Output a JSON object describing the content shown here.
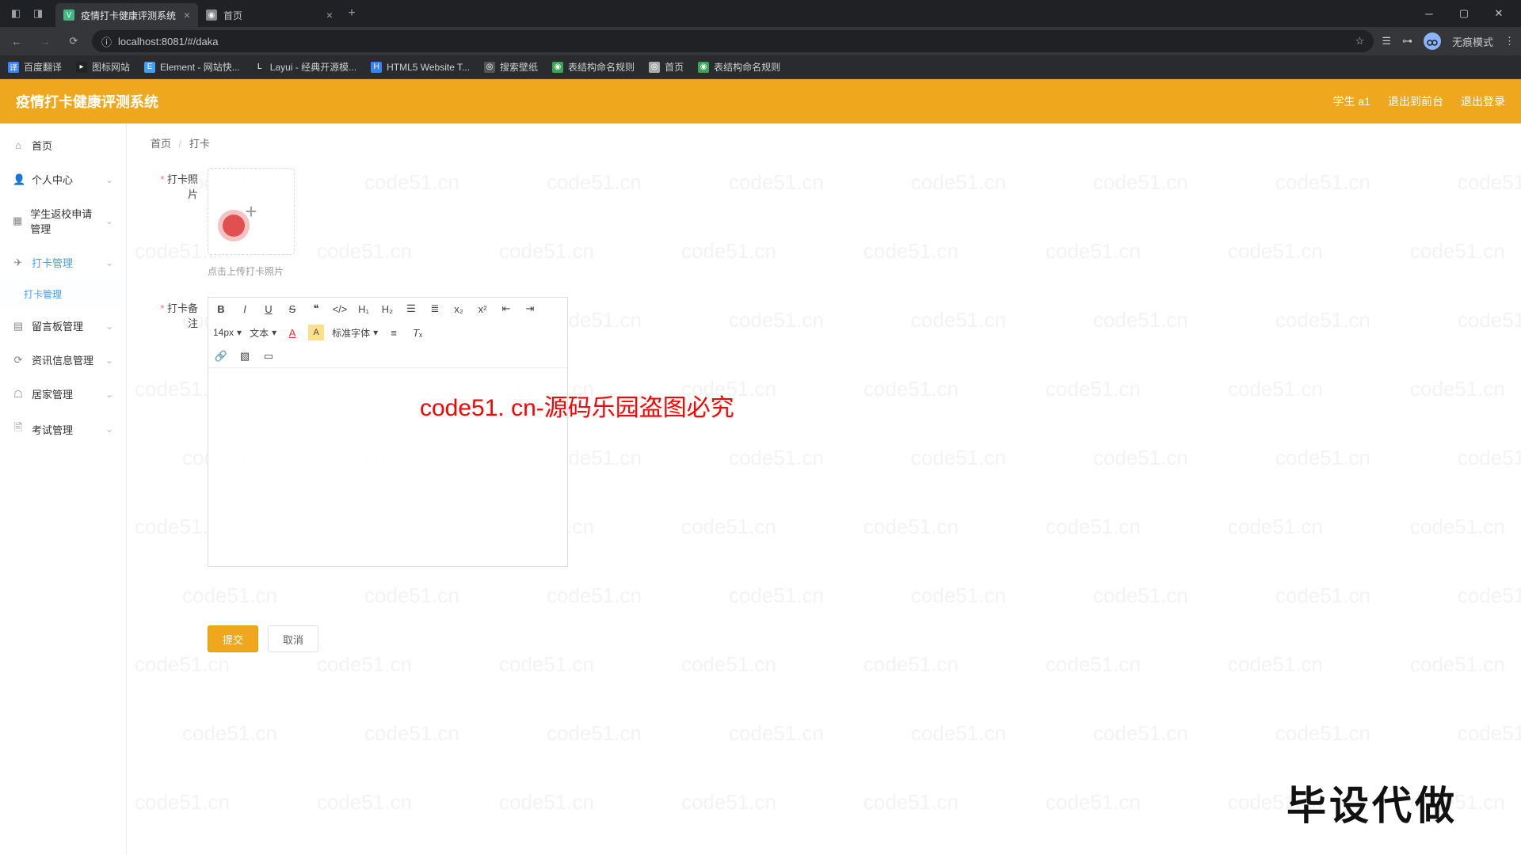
{
  "colors": {
    "accent": "#efa81e",
    "link": "#409EFF",
    "danger": "#f56c6c"
  },
  "browser": {
    "tabs": [
      {
        "title": "疫情打卡健康评测系统",
        "active": true,
        "favicon": "V",
        "favbg": "#41b883"
      },
      {
        "title": "首页",
        "active": false,
        "favicon": "◉",
        "favbg": "#888"
      }
    ],
    "url": "localhost:8081/#/daka",
    "incognito": "无痕模式",
    "bookmarks": [
      {
        "label": "百度翻译",
        "ic": "译",
        "bg": "#3b82f6"
      },
      {
        "label": "图标网站",
        "ic": "▸",
        "bg": "#222"
      },
      {
        "label": "Element - 网站快...",
        "ic": "E",
        "bg": "#409eff"
      },
      {
        "label": "Layui - 经典开源模...",
        "ic": "L",
        "bg": "#2a2a2a"
      },
      {
        "label": "HTML5 Website T...",
        "ic": "H",
        "bg": "#3b82f6"
      },
      {
        "label": "搜索壁纸",
        "ic": "◎",
        "bg": "#555"
      },
      {
        "label": "表结构命名规则",
        "ic": "◉",
        "bg": "#3aa655"
      },
      {
        "label": "首页",
        "ic": "◎",
        "bg": "#aaa"
      },
      {
        "label": "表结构命名规则",
        "ic": "◉",
        "bg": "#3aa655"
      }
    ]
  },
  "header": {
    "title": "疫情打卡健康评测系统",
    "user": "学生 a1",
    "back": "退出到前台",
    "logout": "退出登录"
  },
  "sidebar": {
    "items": [
      {
        "label": "首页",
        "icon": "⌂"
      },
      {
        "label": "个人中心",
        "icon": "👤",
        "caret": true
      },
      {
        "label": "学生返校申请管理",
        "icon": "▦",
        "caret": true
      },
      {
        "label": "打卡管理",
        "icon": "✈",
        "caret": true,
        "active": true,
        "sub": "打卡管理"
      },
      {
        "label": "留言板管理",
        "icon": "▤",
        "caret": true
      },
      {
        "label": "资讯信息管理",
        "icon": "⟳",
        "caret": true
      },
      {
        "label": "居家管理",
        "icon": "☖",
        "caret": true
      },
      {
        "label": "考试管理",
        "icon": "🖹",
        "caret": true
      }
    ]
  },
  "breadcrumb": {
    "a": "首页",
    "b": "打卡"
  },
  "form": {
    "photo_label": "打卡照片",
    "upload_hint": "点击上传打卡照片",
    "note_label": "打卡备注",
    "submit": "提交",
    "cancel": "取消"
  },
  "editor": {
    "size": "14px",
    "mode": "文本",
    "font": "标准字体"
  },
  "watermark_text": "code51.cn",
  "overlay_text": "code51. cn-源码乐园盗图必究",
  "stamp": "毕设代做"
}
